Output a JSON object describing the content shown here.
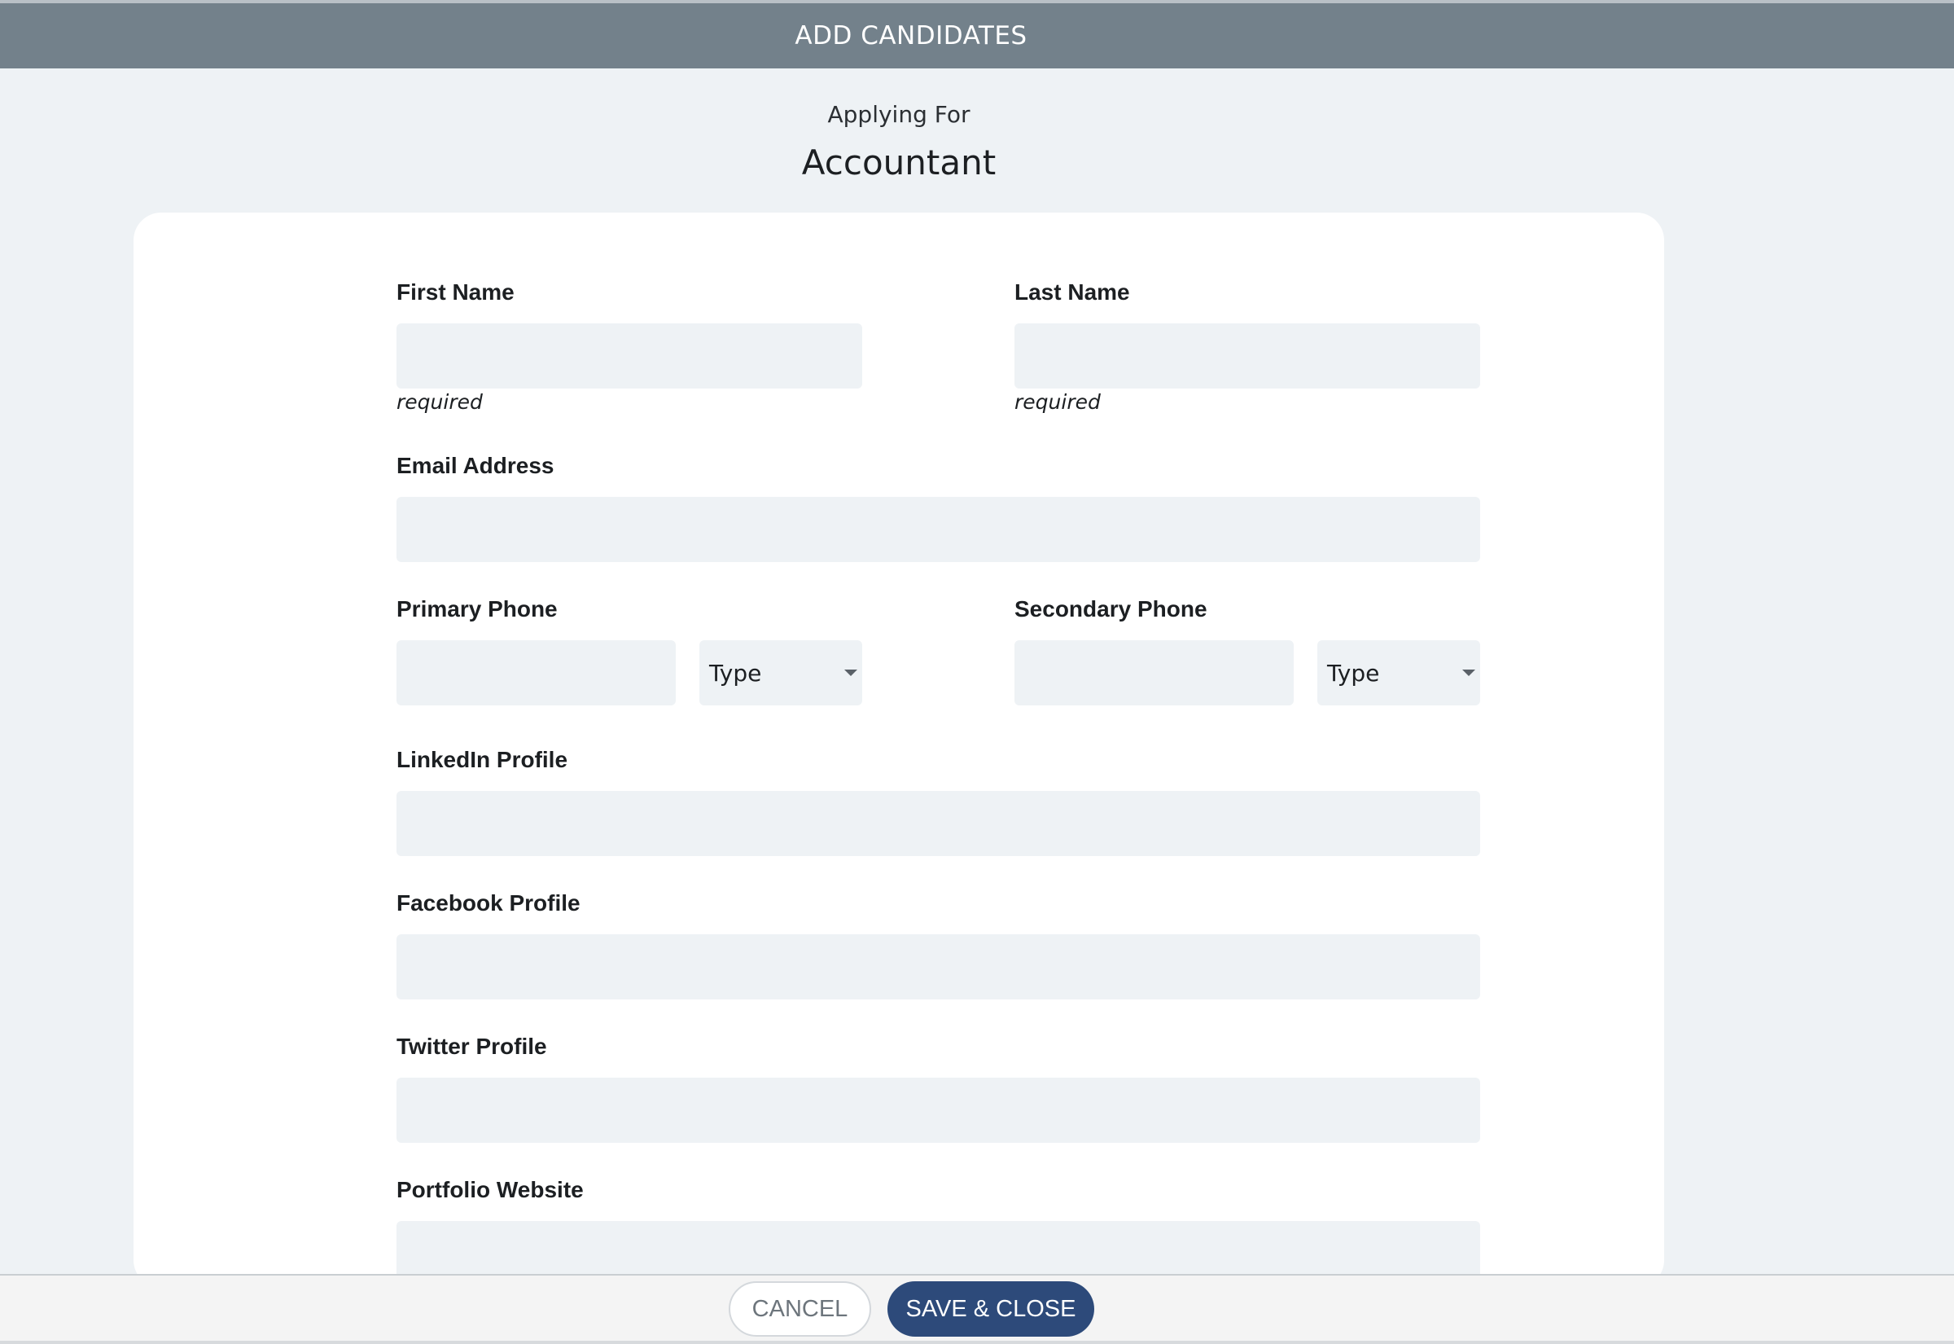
{
  "header": {
    "title": "ADD CANDIDATES"
  },
  "job": {
    "applying_label": "Applying For",
    "title": "Accountant"
  },
  "form": {
    "first_name": {
      "label": "First Name",
      "hint": "required",
      "value": ""
    },
    "last_name": {
      "label": "Last Name",
      "hint": "required",
      "value": ""
    },
    "email": {
      "label": "Email Address",
      "value": ""
    },
    "primary_phone": {
      "label": "Primary Phone",
      "value": "",
      "type_selected": "Type"
    },
    "secondary_phone": {
      "label": "Secondary Phone",
      "value": "",
      "type_selected": "Type"
    },
    "linkedin": {
      "label": "LinkedIn Profile",
      "value": ""
    },
    "facebook": {
      "label": "Facebook Profile",
      "value": ""
    },
    "twitter": {
      "label": "Twitter Profile",
      "value": ""
    },
    "portfolio": {
      "label": "Portfolio Website",
      "value": ""
    }
  },
  "footer": {
    "cancel_label": "CANCEL",
    "save_label": "SAVE & CLOSE"
  },
  "colors": {
    "header_bg": "#73818b",
    "page_bg": "#eef2f5",
    "input_bg": "#eef2f5",
    "primary_button": "#2d4a7a"
  },
  "icons": {
    "select_caret": "caret-down-icon"
  }
}
